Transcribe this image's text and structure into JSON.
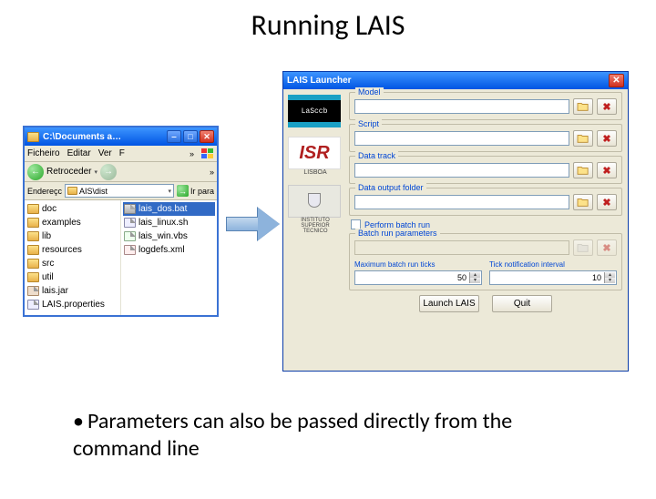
{
  "slide": {
    "title": "Running LAIS",
    "bullet": "Parameters can also be passed directly from the command line"
  },
  "explorer": {
    "title": "C:\\Documents a…",
    "menu": {
      "file": "Ficheiro",
      "edit": "Editar",
      "view": "Ver",
      "f": "F"
    },
    "back_label": "Retroceder",
    "address_label": "Endereçc",
    "address_value": "AIS\\dist",
    "go_label": "Ir para",
    "left_files": [
      {
        "name": "doc",
        "type": "folder"
      },
      {
        "name": "examples",
        "type": "folder"
      },
      {
        "name": "lib",
        "type": "folder"
      },
      {
        "name": "resources",
        "type": "folder"
      },
      {
        "name": "src",
        "type": "folder"
      },
      {
        "name": "util",
        "type": "folder"
      },
      {
        "name": "lais.jar",
        "type": "jar"
      },
      {
        "name": "LAIS.properties",
        "type": "prop"
      }
    ],
    "right_files": [
      {
        "name": "lais_dos.bat",
        "type": "bat",
        "selected": true
      },
      {
        "name": "lais_linux.sh",
        "type": "sh"
      },
      {
        "name": "lais_win.vbs",
        "type": "vbs"
      },
      {
        "name": "logdefs.xml",
        "type": "xml"
      }
    ]
  },
  "launcher": {
    "title": "LAIS Launcher",
    "logos": {
      "lascb": "LaSccb",
      "isr_caption": "LISBOA",
      "ist_caption": "INSTITUTO\nSUPERIOR\nTECNICO"
    },
    "groups": {
      "model": "Model",
      "script": "Script",
      "data_track": "Data track",
      "data_output": "Data output folder",
      "batch": "Batch run parameters"
    },
    "batch_checkbox": "Perform batch run",
    "max_ticks": {
      "label": "Maximum batch run ticks",
      "value": "50"
    },
    "interval": {
      "label": "Tick notification interval",
      "value": "10"
    },
    "buttons": {
      "launch": "Launch LAIS",
      "quit": "Quit"
    }
  }
}
